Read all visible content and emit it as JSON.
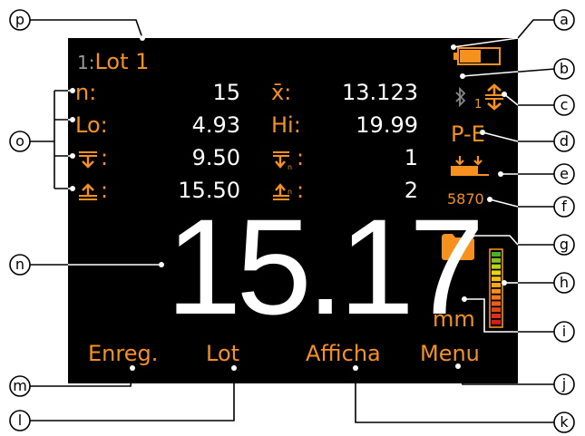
{
  "header": {
    "lot_prefix": "1:",
    "lot_name": "Lot 1"
  },
  "stats": [
    {
      "label": "n:",
      "value": "15",
      "label2": "x̄:",
      "value2": "13.123"
    },
    {
      "label": "Lo:",
      "value": "4.93",
      "label2": "Hi:",
      "value2": "19.99"
    },
    {
      "label": ":",
      "value": "9.50",
      "label2": ":",
      "value2": "1"
    },
    {
      "label": ":",
      "value": "15.50",
      "label2": ":",
      "value2": "2"
    }
  ],
  "reading": {
    "value": "15.17",
    "unit": "mm"
  },
  "status": {
    "probe_index": "1",
    "mode": "P-E",
    "code": "5870",
    "battery_level": 0.55,
    "signal_level": 0.5
  },
  "softkeys": [
    "Enreg.",
    "Lot",
    "Afficha",
    "Menu"
  ],
  "callouts": {
    "a": "a",
    "b": "b",
    "c": "c",
    "d": "d",
    "e": "e",
    "f": "f",
    "g": "g",
    "h": "h",
    "i": "i",
    "j": "j",
    "k": "k",
    "l": "l",
    "m": "m",
    "n": "n",
    "o": "o",
    "p": "p"
  },
  "colors": {
    "accent": "#f6901e",
    "screen": "#000000",
    "text": "#ffffff"
  },
  "icons": [
    "battery-icon",
    "bluetooth-icon",
    "probe-icon",
    "limits-icon",
    "folder-icon",
    "signal-bar-icon"
  ]
}
